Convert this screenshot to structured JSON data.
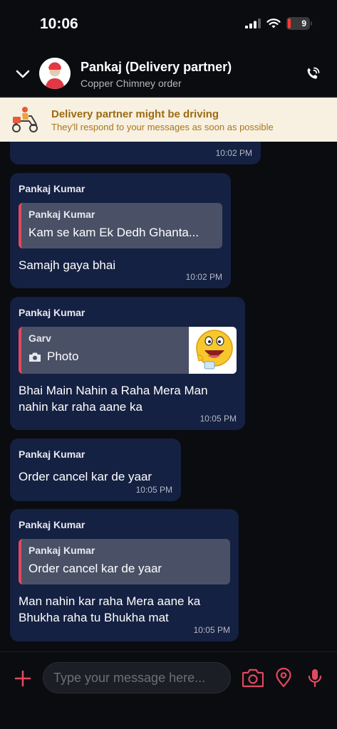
{
  "status": {
    "time": "10:06",
    "battery": "9"
  },
  "header": {
    "title": "Pankaj (Delivery partner)",
    "subtitle": "Copper Chimney order"
  },
  "banner": {
    "title": "Delivery partner might be driving",
    "subtitle": "They'll respond to your messages as soon as possible"
  },
  "messages": [
    {
      "time": "10:02 PM"
    },
    {
      "sender": "Pankaj Kumar",
      "quote_sender": "Pankaj Kumar",
      "quote_text": "Kam se kam Ek Dedh Ghanta...",
      "text": "Samajh gaya bhai",
      "time": "10:02 PM"
    },
    {
      "sender": "Pankaj Kumar",
      "quote_sender": "Garv",
      "quote_text": "Photo",
      "text": "Bhai Main Nahin a Raha Mera Man nahin kar raha aane ka",
      "time": "10:05 PM"
    },
    {
      "sender": "Pankaj Kumar",
      "text": "Order cancel kar de yaar",
      "time": "10:05 PM"
    },
    {
      "sender": "Pankaj Kumar",
      "quote_sender": "Pankaj Kumar",
      "quote_text": "Order cancel kar de yaar",
      "text": "Man nahin kar raha Mera aane ka Bhukha raha tu Bhukha mat",
      "time": "10:05 PM"
    }
  ],
  "composer": {
    "placeholder": "Type your message here..."
  },
  "colors": {
    "background": "#0b0c10",
    "bubble": "#152142",
    "quote": "#4a5166",
    "accent": "#e2485f",
    "banner_bg": "#f8f0e0",
    "banner_text": "#9c6b12"
  },
  "icons": {
    "back": "chevron-down-icon",
    "call": "phone-call-icon",
    "banner": "scooter-icon",
    "photo": "camera-icon",
    "attach": "plus-icon",
    "camera": "camera-icon",
    "location": "location-pin-icon",
    "mic": "microphone-icon"
  }
}
